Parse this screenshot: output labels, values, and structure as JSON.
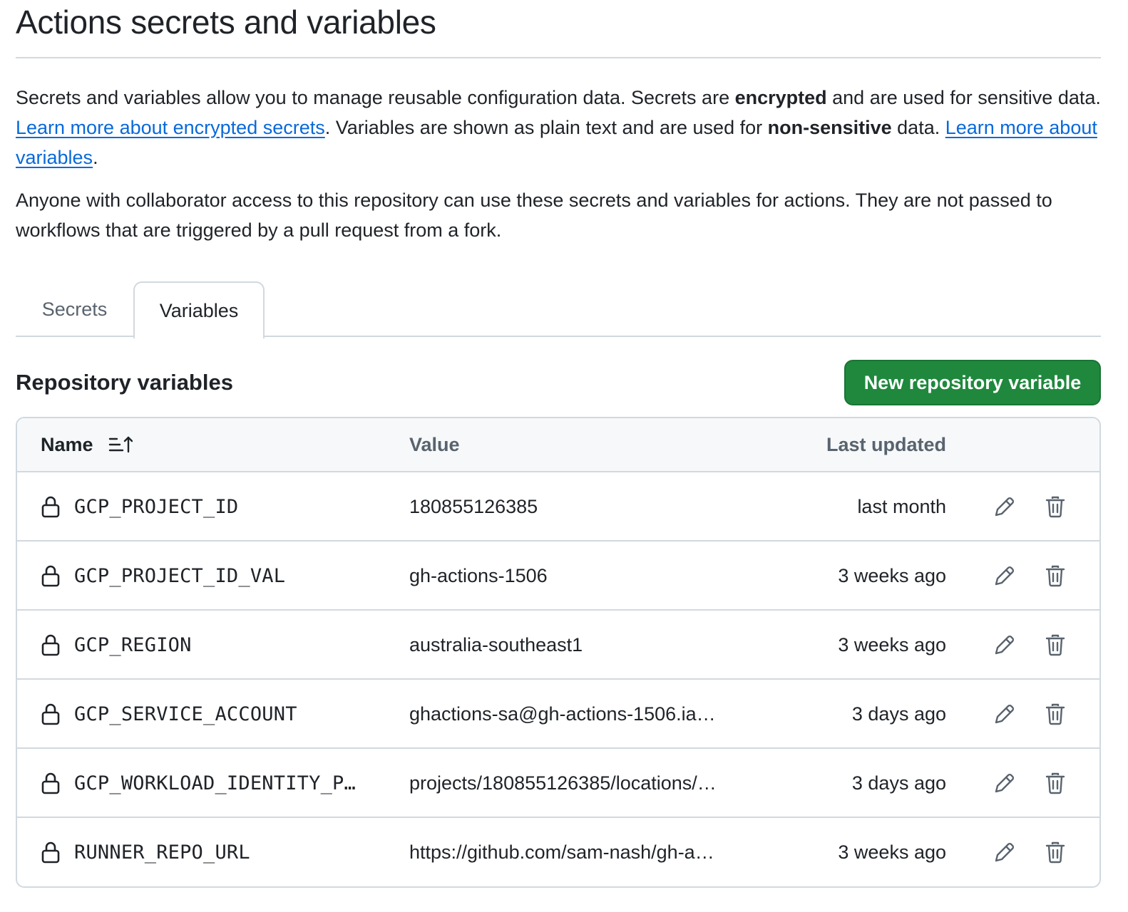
{
  "page": {
    "title": "Actions secrets and variables"
  },
  "intro": {
    "p1_part1": "Secrets and variables allow you to manage reusable configuration data. Secrets are ",
    "p1_bold1": "encrypted",
    "p1_part2": " and are used for sensitive data. ",
    "p1_link1": "Learn more about encrypted secrets",
    "p1_part3": ". Variables are shown as plain text and are used for ",
    "p1_bold2": "non-sensitive",
    "p1_part4": " data. ",
    "p1_link2": "Learn more about variables",
    "p1_part5": ".",
    "p2": "Anyone with collaborator access to this repository can use these secrets and variables for actions. They are not passed to workflows that are triggered by a pull request from a fork."
  },
  "tabs": [
    {
      "label": "Secrets",
      "selected": false
    },
    {
      "label": "Variables",
      "selected": true
    }
  ],
  "section": {
    "title": "Repository variables",
    "new_button": "New repository variable"
  },
  "table": {
    "headers": {
      "name": "Name",
      "value": "Value",
      "updated": "Last updated"
    },
    "rows": [
      {
        "name": "GCP_PROJECT_ID",
        "value": "180855126385",
        "updated": "last month"
      },
      {
        "name": "GCP_PROJECT_ID_VAL",
        "value": "gh-actions-1506",
        "updated": "3 weeks ago"
      },
      {
        "name": "GCP_REGION",
        "value": "australia-southeast1",
        "updated": "3 weeks ago"
      },
      {
        "name": "GCP_SERVICE_ACCOUNT",
        "value": "ghactions-sa@gh-actions-1506.ia…",
        "updated": "3 days ago"
      },
      {
        "name": "GCP_WORKLOAD_IDENTITY_P…",
        "value": "projects/180855126385/locations/…",
        "updated": "3 days ago"
      },
      {
        "name": "RUNNER_REPO_URL",
        "value": "https://github.com/sam-nash/gh-a…",
        "updated": "3 weeks ago"
      }
    ]
  },
  "colors": {
    "primary_button": "#1f883d",
    "link": "#0969da",
    "border": "#d1d9e0",
    "header_bg": "#f6f8fa"
  },
  "icons": {
    "row_icon": "lock-icon",
    "edit": "pencil-icon",
    "delete": "trash-icon",
    "sort": "sort-ascending-icon"
  }
}
